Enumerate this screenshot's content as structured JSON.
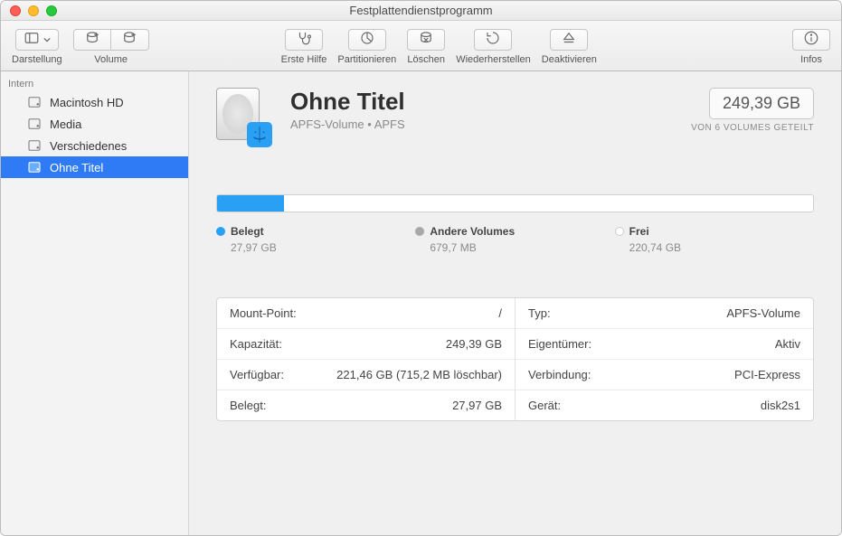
{
  "window": {
    "title": "Festplattendienstprogramm"
  },
  "toolbar": {
    "view_label": "Darstellung",
    "volume_label": "Volume",
    "first_aid_label": "Erste Hilfe",
    "partition_label": "Partitionieren",
    "erase_label": "Löschen",
    "restore_label": "Wiederherstellen",
    "unmount_label": "Deaktivieren",
    "info_label": "Infos"
  },
  "sidebar": {
    "section_label": "Intern",
    "items": [
      {
        "label": "Macintosh HD",
        "selected": false
      },
      {
        "label": "Media",
        "selected": false
      },
      {
        "label": "Verschiedenes",
        "selected": false
      },
      {
        "label": "Ohne Titel",
        "selected": true
      }
    ]
  },
  "volume": {
    "name": "Ohne Titel",
    "subtitle": "APFS-Volume • APFS",
    "capacity_display": "249,39 GB",
    "capacity_sub": "VON 6 VOLUMES GETEILT"
  },
  "usage": {
    "used_pct": 11.2,
    "legend": [
      {
        "label": "Belegt",
        "value": "27,97 GB",
        "color": "#2aa0f5"
      },
      {
        "label": "Andere Volumes",
        "value": "679,7 MB",
        "color": "#a8a8a8"
      },
      {
        "label": "Frei",
        "value": "220,74 GB",
        "color": "#ffffff"
      }
    ]
  },
  "details": {
    "left": [
      {
        "key": "Mount-Point:",
        "value": "/"
      },
      {
        "key": "Kapazität:",
        "value": "249,39 GB"
      },
      {
        "key": "Verfügbar:",
        "value": "221,46 GB (715,2 MB löschbar)"
      },
      {
        "key": "Belegt:",
        "value": "27,97 GB"
      }
    ],
    "right": [
      {
        "key": "Typ:",
        "value": "APFS-Volume"
      },
      {
        "key": "Eigentümer:",
        "value": "Aktiv"
      },
      {
        "key": "Verbindung:",
        "value": "PCI-Express"
      },
      {
        "key": "Gerät:",
        "value": "disk2s1"
      }
    ]
  }
}
